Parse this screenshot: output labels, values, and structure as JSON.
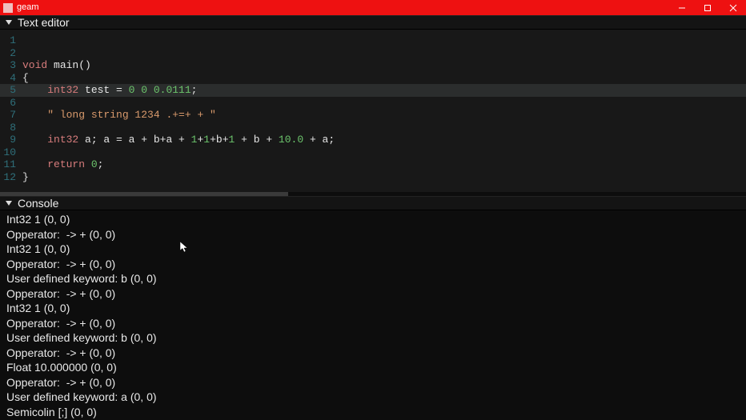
{
  "window": {
    "title": "geam"
  },
  "panels": {
    "editor_title": "Text editor",
    "console_title": "Console"
  },
  "editor": {
    "lines": [
      {
        "n": 1,
        "tokens": []
      },
      {
        "n": 2,
        "tokens": []
      },
      {
        "n": 3,
        "tokens": [
          {
            "cls": "tok-type",
            "t": "void "
          },
          {
            "cls": "tok-ident",
            "t": "main()"
          }
        ]
      },
      {
        "n": 4,
        "tokens": [
          {
            "cls": "tok-punct",
            "t": "{"
          }
        ]
      },
      {
        "n": 5,
        "highlight": true,
        "tokens": [
          {
            "cls": "tok-punct",
            "t": "    "
          },
          {
            "cls": "tok-type",
            "t": "int32 "
          },
          {
            "cls": "tok-ident",
            "t": "test = "
          },
          {
            "cls": "tok-num",
            "t": "0 0 0.0111"
          },
          {
            "cls": "tok-punct",
            "t": ";"
          }
        ]
      },
      {
        "n": 6,
        "tokens": []
      },
      {
        "n": 7,
        "tokens": [
          {
            "cls": "tok-punct",
            "t": "    "
          },
          {
            "cls": "tok-str",
            "t": "\" long string 1234 .+=+ + \""
          }
        ]
      },
      {
        "n": 8,
        "tokens": []
      },
      {
        "n": 9,
        "tokens": [
          {
            "cls": "tok-punct",
            "t": "    "
          },
          {
            "cls": "tok-type",
            "t": "int32 "
          },
          {
            "cls": "tok-ident",
            "t": "a; a = a + b+a + "
          },
          {
            "cls": "tok-num",
            "t": "1"
          },
          {
            "cls": "tok-ident",
            "t": "+"
          },
          {
            "cls": "tok-num",
            "t": "1"
          },
          {
            "cls": "tok-ident",
            "t": "+b+"
          },
          {
            "cls": "tok-num",
            "t": "1"
          },
          {
            "cls": "tok-ident",
            "t": " + b + "
          },
          {
            "cls": "tok-num",
            "t": "10.0"
          },
          {
            "cls": "tok-ident",
            "t": " + a;"
          }
        ]
      },
      {
        "n": 10,
        "tokens": []
      },
      {
        "n": 11,
        "tokens": [
          {
            "cls": "tok-punct",
            "t": "    "
          },
          {
            "cls": "tok-kw",
            "t": "return "
          },
          {
            "cls": "tok-num",
            "t": "0"
          },
          {
            "cls": "tok-punct",
            "t": ";"
          }
        ]
      },
      {
        "n": 12,
        "tokens": [
          {
            "cls": "tok-punct",
            "t": "}"
          }
        ]
      }
    ]
  },
  "console": {
    "lines": [
      "Int32 1 (0, 0)",
      "Opperator:  -> + (0, 0)",
      "Int32 1 (0, 0)",
      "Opperator:  -> + (0, 0)",
      "User defined keyword: b (0, 0)",
      "Opperator:  -> + (0, 0)",
      "Int32 1 (0, 0)",
      "Opperator:  -> + (0, 0)",
      "User defined keyword: b (0, 0)",
      "Opperator:  -> + (0, 0)",
      "Float 10.000000 (0, 0)",
      "Opperator:  -> + (0, 0)",
      "User defined keyword: a (0, 0)",
      "Semicolin [;] (0, 0)"
    ]
  }
}
